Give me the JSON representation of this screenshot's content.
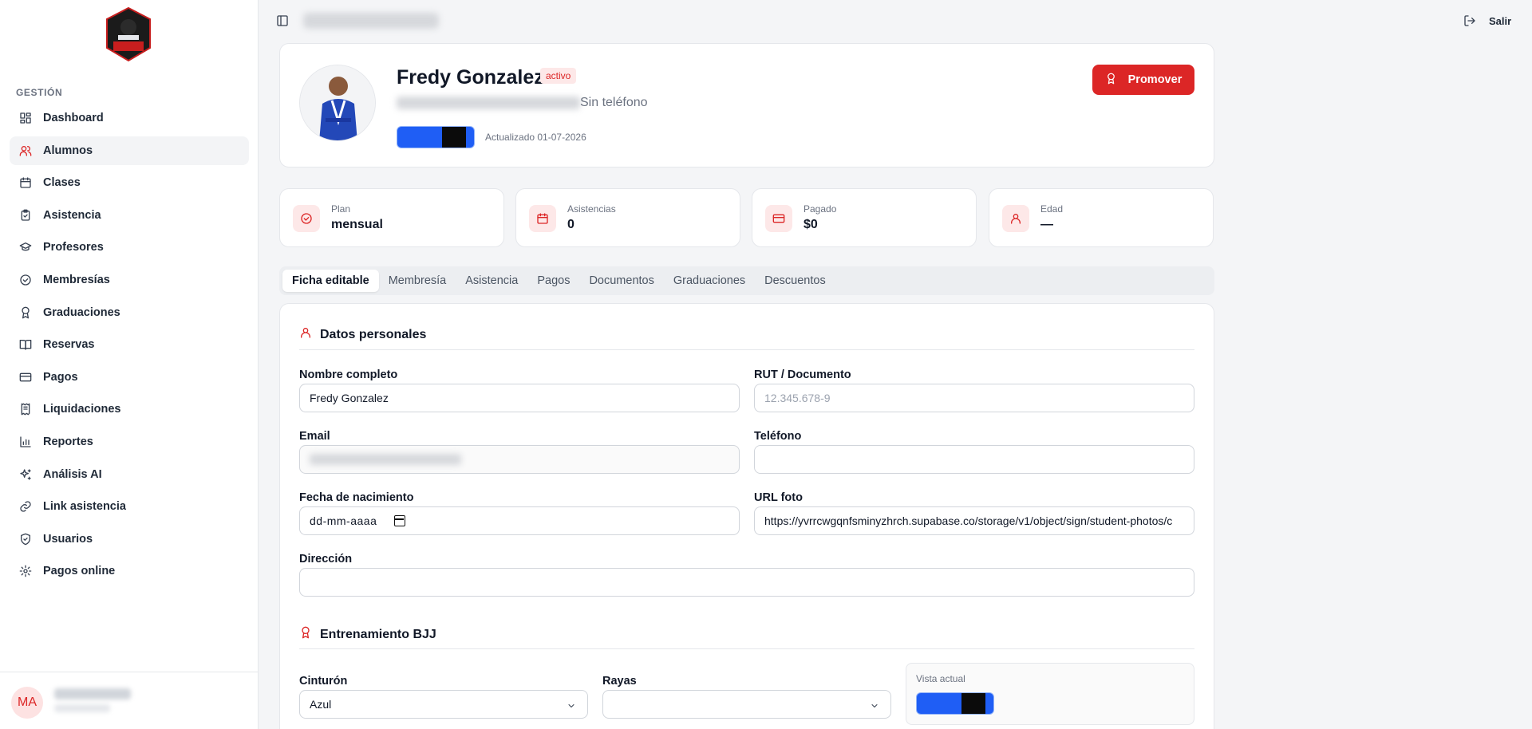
{
  "sidebar": {
    "section_label": "GESTIÓN",
    "items": [
      {
        "label": "Dashboard",
        "icon": "dashboard-icon",
        "active": false
      },
      {
        "label": "Alumnos",
        "icon": "users-icon",
        "active": true
      },
      {
        "label": "Clases",
        "icon": "calendar-icon",
        "active": false
      },
      {
        "label": "Asistencia",
        "icon": "clipboard-check-icon",
        "active": false
      },
      {
        "label": "Profesores",
        "icon": "graduation-cap-icon",
        "active": false
      },
      {
        "label": "Membresías",
        "icon": "circle-check-icon",
        "active": false
      },
      {
        "label": "Graduaciones",
        "icon": "award-icon",
        "active": false
      },
      {
        "label": "Reservas",
        "icon": "book-open-icon",
        "active": false
      },
      {
        "label": "Pagos",
        "icon": "credit-card-icon",
        "active": false
      },
      {
        "label": "Liquidaciones",
        "icon": "receipt-icon",
        "active": false
      },
      {
        "label": "Reportes",
        "icon": "bar-chart-icon",
        "active": false
      },
      {
        "label": "Análisis AI",
        "icon": "sparkles-icon",
        "active": false
      },
      {
        "label": "Link asistencia",
        "icon": "link-icon",
        "active": false
      },
      {
        "label": "Usuarios",
        "icon": "shield-icon",
        "active": false
      },
      {
        "label": "Pagos online",
        "icon": "settings-icon",
        "active": false
      }
    ],
    "user": {
      "initials": "MA"
    }
  },
  "topbar": {
    "logout_label": "Salir"
  },
  "profile": {
    "name": "Fredy Gonzalez",
    "status": "activo",
    "phone_text": "Sin teléfono",
    "updated": "Actualizado 01-07-2026",
    "promote_label": "Promover"
  },
  "stats": [
    {
      "label": "Plan",
      "value": "mensual",
      "icon": "circle-check-icon"
    },
    {
      "label": "Asistencias",
      "value": "0",
      "icon": "calendar-icon"
    },
    {
      "label": "Pagado",
      "value": "$0",
      "icon": "credit-card-icon"
    },
    {
      "label": "Edad",
      "value": "—",
      "icon": "user-icon"
    }
  ],
  "tabs": [
    {
      "label": "Ficha editable",
      "active": true
    },
    {
      "label": "Membresía",
      "active": false
    },
    {
      "label": "Asistencia",
      "active": false
    },
    {
      "label": "Pagos",
      "active": false
    },
    {
      "label": "Documentos",
      "active": false
    },
    {
      "label": "Graduaciones",
      "active": false
    },
    {
      "label": "Descuentos",
      "active": false
    }
  ],
  "personal": {
    "title": "Datos personales",
    "full_name_label": "Nombre completo",
    "full_name_value": "Fredy Gonzalez",
    "rut_label": "RUT / Documento",
    "rut_placeholder": "12.345.678-9",
    "email_label": "Email",
    "phone_label": "Teléfono",
    "birth_label": "Fecha de nacimiento",
    "birth_placeholder": "dd-mm-aaaa",
    "photo_label": "URL foto",
    "photo_value": "https://yvrrcwgqnfsminyzhrch.supabase.co/storage/v1/object/sign/student-photos/c",
    "address_label": "Dirección"
  },
  "training": {
    "title": "Entrenamiento BJJ",
    "belt_label": "Cinturón",
    "belt_value": "Azul",
    "stripes_label": "Rayas",
    "stripes_value": "",
    "preview_label": "Vista actual"
  },
  "colors": {
    "accent": "#dc2626",
    "belt_blue": "#1f5ef5",
    "belt_black": "#0b0b0b"
  }
}
